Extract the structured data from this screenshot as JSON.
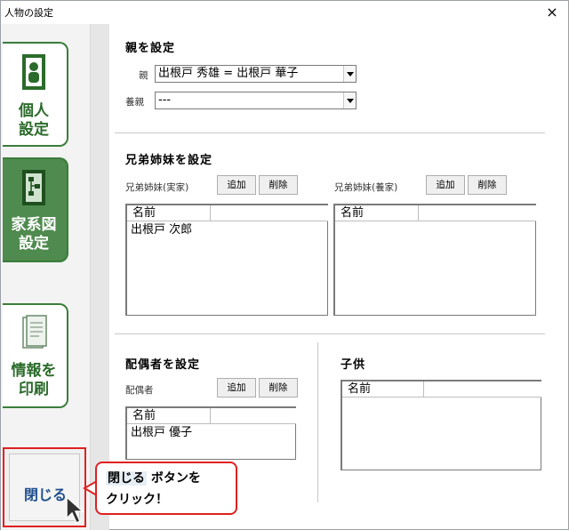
{
  "window": {
    "title": "人物の設定",
    "close_glyph": "×"
  },
  "sidebar": {
    "personal_line1": "個人",
    "personal_line2": "設定",
    "family_line1": "家系図",
    "family_line2": "設定",
    "print_line1": "情報を",
    "print_line2": "印刷",
    "close_label": "閉じる"
  },
  "parents": {
    "title": "親を設定",
    "parent_label": "親",
    "parent_value": "出根戸 秀雄 = 出根戸 華子",
    "adoptive_label": "養親",
    "adoptive_value": "---"
  },
  "siblings": {
    "title": "兄弟姉妹を設定",
    "bio_label": "兄弟姉妹(実家)",
    "adopt_label": "兄弟姉妹(養家)",
    "add_label": "追加",
    "delete_label": "削除",
    "col_name": "名前",
    "bio_rows": [
      "出根戸 次郎"
    ]
  },
  "spouse": {
    "title": "配偶者を設定",
    "label": "配偶者",
    "add_label": "追加",
    "delete_label": "削除",
    "col_name": "名前",
    "rows": [
      "出根戸 優子"
    ]
  },
  "children": {
    "title": "子供",
    "col_name": "名前"
  },
  "callout": {
    "highlight": "閉じる",
    "line1_rest": " ボタンを",
    "line2": "クリック！"
  },
  "colors": {
    "accent_green": "#3a7d3a",
    "active_green": "#4f8a4f",
    "callout_red": "#e02020"
  }
}
